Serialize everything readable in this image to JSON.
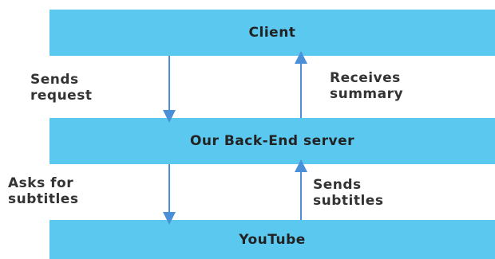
{
  "boxes": {
    "client": "Client",
    "server": "Our Back-End server",
    "youtube": "YouTube"
  },
  "arrows": {
    "client_to_server": [
      "Sends",
      "request"
    ],
    "server_to_client": [
      "Receives",
      "summary"
    ],
    "server_to_youtube": [
      "Asks for",
      "subtitles"
    ],
    "youtube_to_server": [
      "Sends",
      "subtitles"
    ]
  },
  "colors": {
    "box_fill": "#5bc8ef",
    "arrow": "#4a90d9"
  }
}
